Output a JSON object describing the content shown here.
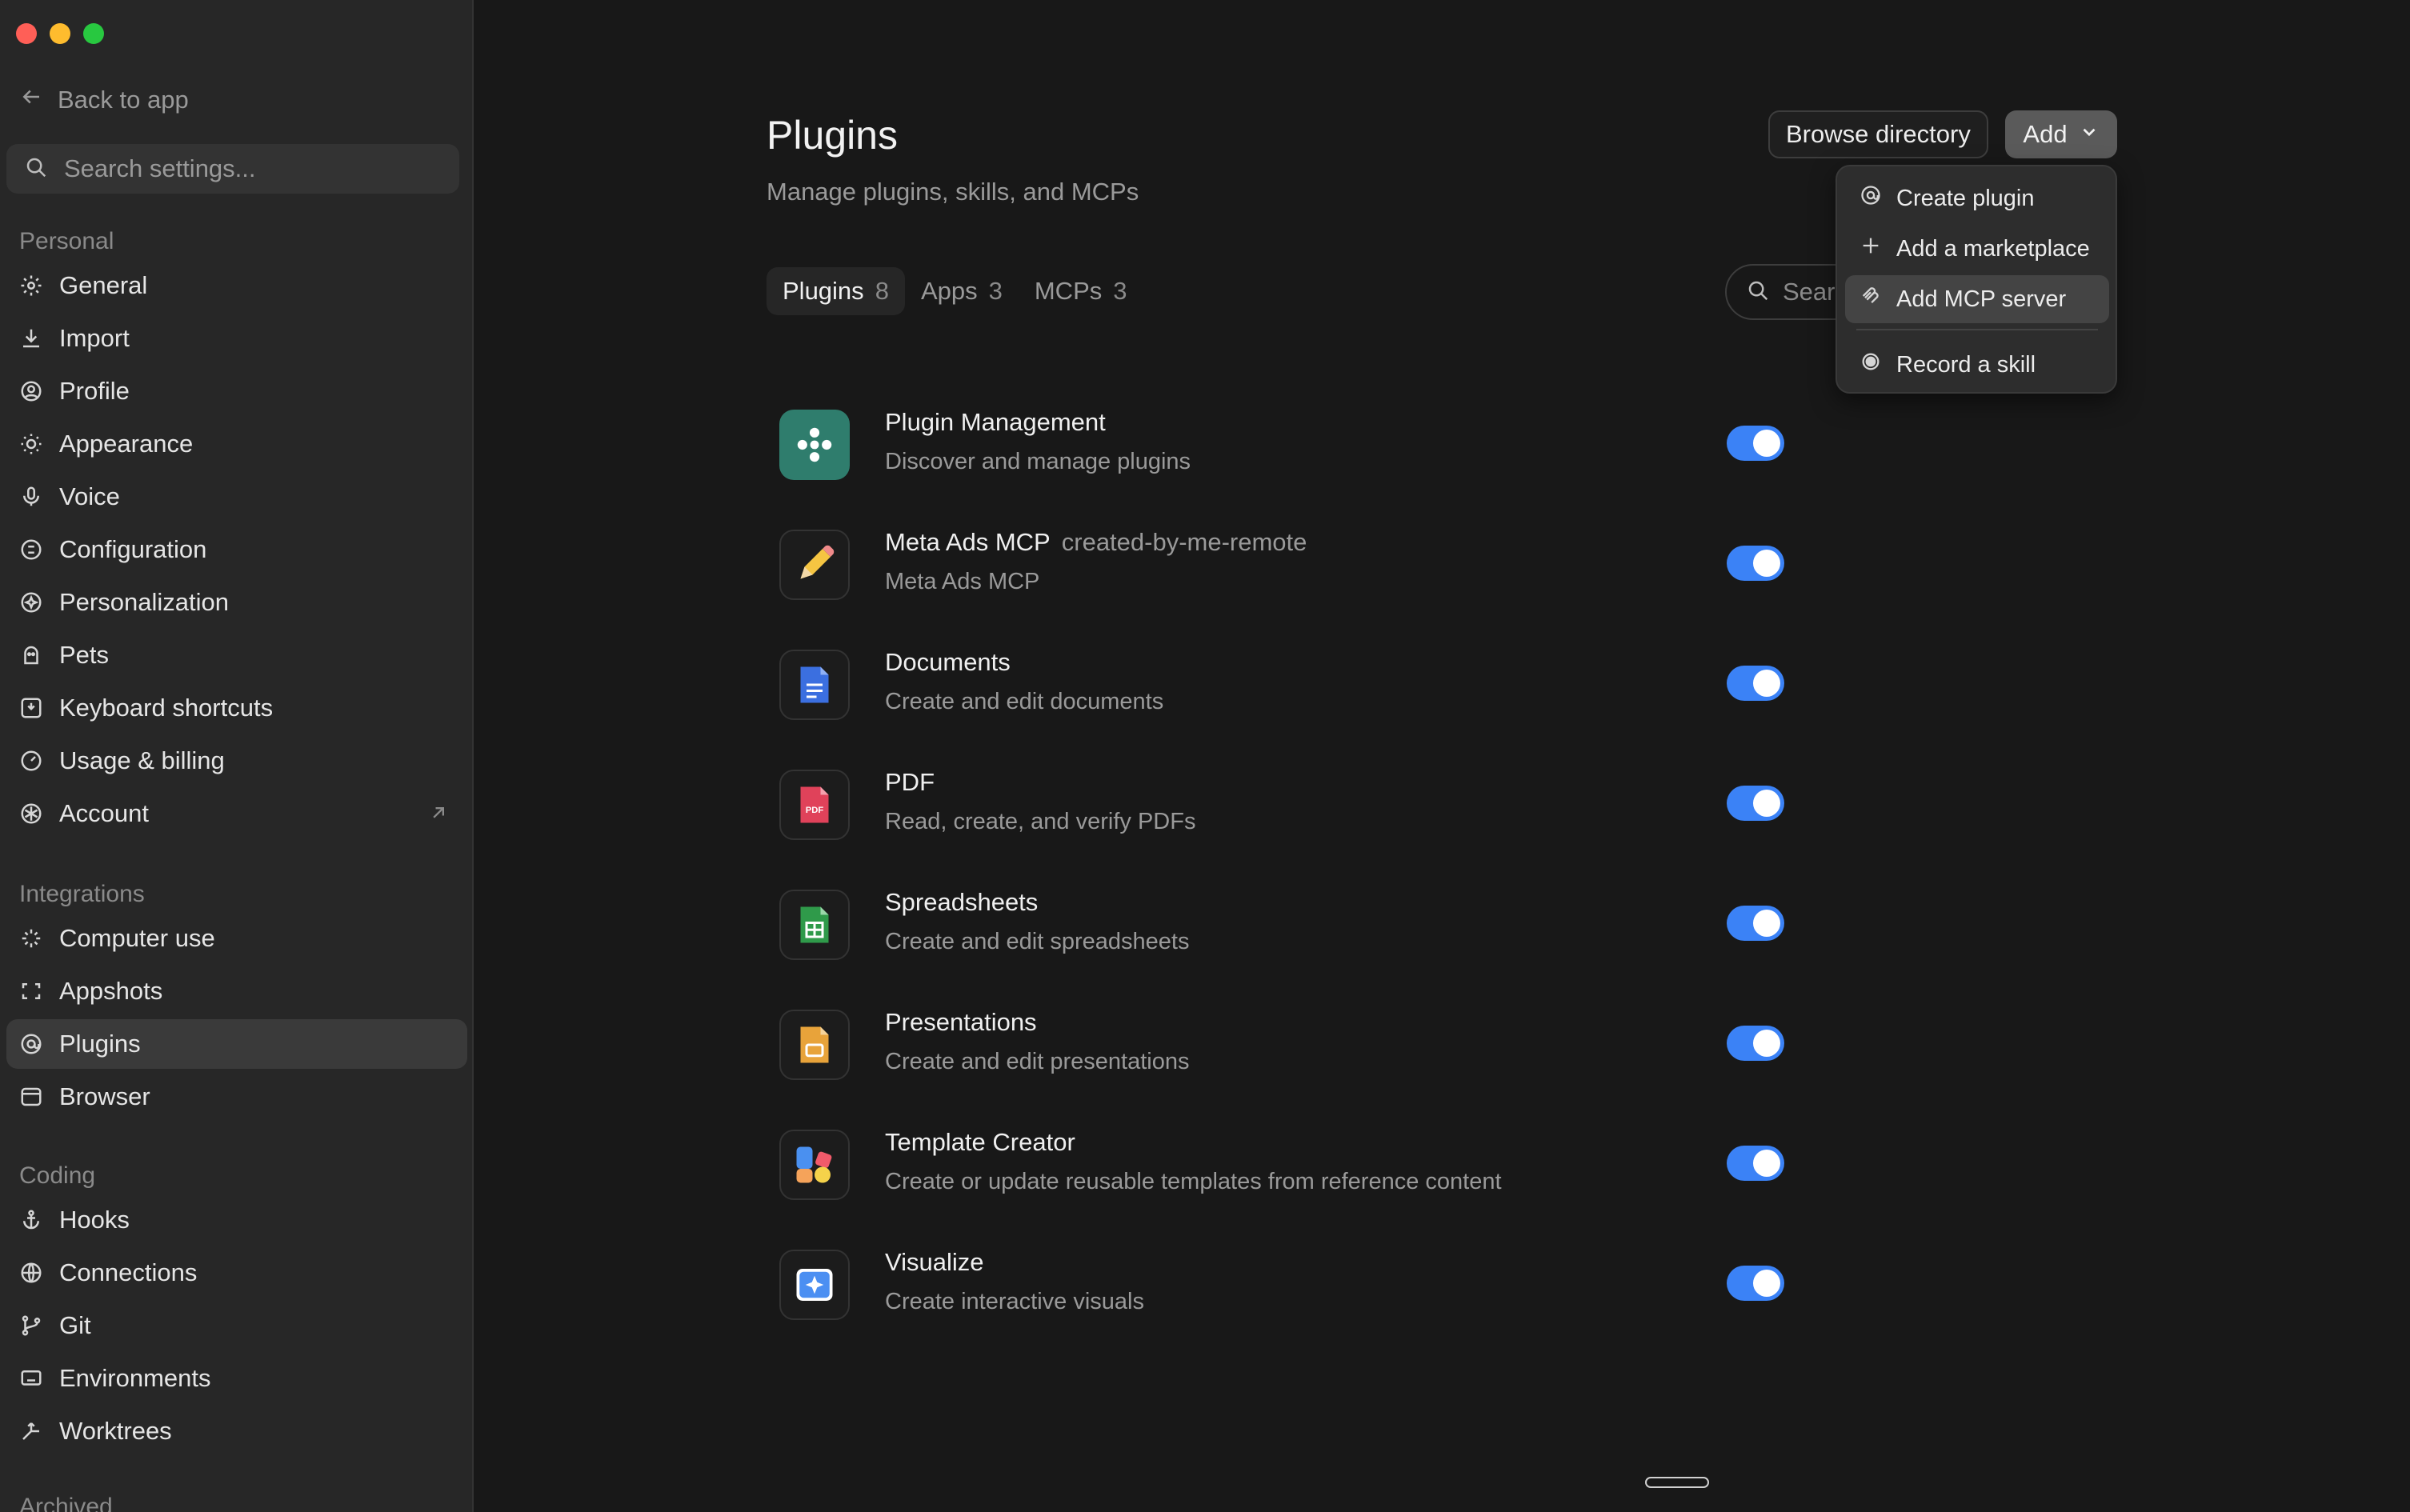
{
  "window": {
    "controls": [
      {
        "name": "close",
        "color": "#ff5f57"
      },
      {
        "name": "minimize",
        "color": "#febc2e"
      },
      {
        "name": "maximize",
        "color": "#28c840"
      }
    ]
  },
  "sidebar": {
    "back_label": "Back to app",
    "search_placeholder": "Search settings...",
    "sections": {
      "personal": {
        "title": "Personal",
        "items": [
          {
            "label": "General",
            "icon": "gear-icon"
          },
          {
            "label": "Import",
            "icon": "download-icon"
          },
          {
            "label": "Profile",
            "icon": "user-icon"
          },
          {
            "label": "Appearance",
            "icon": "sun-icon"
          },
          {
            "label": "Voice",
            "icon": "microphone-icon"
          },
          {
            "label": "Configuration",
            "icon": "sliders-icon"
          },
          {
            "label": "Personalization",
            "icon": "sparkle-icon"
          },
          {
            "label": "Pets",
            "icon": "pet-icon"
          },
          {
            "label": "Keyboard shortcuts",
            "icon": "keyboard-icon"
          },
          {
            "label": "Usage & billing",
            "icon": "gauge-icon"
          },
          {
            "label": "Account",
            "icon": "openai-icon",
            "external": true
          }
        ]
      },
      "integrations": {
        "title": "Integrations",
        "items": [
          {
            "label": "Computer use",
            "icon": "cursor-sparkle-icon"
          },
          {
            "label": "Appshots",
            "icon": "screenshot-icon"
          },
          {
            "label": "Plugins",
            "icon": "plugin-icon",
            "active": true
          },
          {
            "label": "Browser",
            "icon": "browser-icon"
          }
        ]
      },
      "coding": {
        "title": "Coding",
        "items": [
          {
            "label": "Hooks",
            "icon": "anchor-icon"
          },
          {
            "label": "Connections",
            "icon": "globe-icon"
          },
          {
            "label": "Git",
            "icon": "git-branch-icon"
          },
          {
            "label": "Environments",
            "icon": "monitor-icon"
          },
          {
            "label": "Worktrees",
            "icon": "worktree-icon"
          }
        ]
      },
      "archived": {
        "title": "Archived"
      }
    }
  },
  "main": {
    "title": "Plugins",
    "subtitle": "Manage plugins, skills, and MCPs",
    "browse_label": "Browse directory",
    "add_label": "Add",
    "tabs": [
      {
        "label": "Plugins",
        "count": "8",
        "active": true
      },
      {
        "label": "Apps",
        "count": "3"
      },
      {
        "label": "MCPs",
        "count": "3"
      }
    ],
    "search_placeholder": "Search",
    "plugins": [
      {
        "name": "Plugin Management",
        "tag": "",
        "desc": "Discover and manage plugins",
        "icon": "plugin-management-icon",
        "enabled": true
      },
      {
        "name": "Meta Ads MCP",
        "tag": "created-by-me-remote",
        "desc": "Meta Ads MCP",
        "icon": "pencil-icon",
        "enabled": true
      },
      {
        "name": "Documents",
        "tag": "",
        "desc": "Create and edit documents",
        "icon": "document-icon",
        "enabled": true
      },
      {
        "name": "PDF",
        "tag": "",
        "desc": "Read, create, and verify PDFs",
        "icon": "pdf-icon",
        "icon_text": "PDF",
        "enabled": true
      },
      {
        "name": "Spreadsheets",
        "tag": "",
        "desc": "Create and edit spreadsheets",
        "icon": "spreadsheet-icon",
        "enabled": true
      },
      {
        "name": "Presentations",
        "tag": "",
        "desc": "Create and edit presentations",
        "icon": "presentation-icon",
        "enabled": true
      },
      {
        "name": "Template Creator",
        "tag": "",
        "desc": "Create or update reusable templates from reference content",
        "icon": "template-icon",
        "enabled": true
      },
      {
        "name": "Visualize",
        "tag": "",
        "desc": "Create interactive visuals",
        "icon": "visualize-icon",
        "enabled": true
      }
    ]
  },
  "add_menu": {
    "items": [
      {
        "label": "Create plugin",
        "icon": "plugin-icon"
      },
      {
        "label": "Add a marketplace",
        "icon": "plus-icon"
      },
      {
        "label": "Add MCP server",
        "icon": "mcp-icon",
        "highlight": true
      },
      {
        "label": "Record a skill",
        "icon": "record-icon"
      }
    ]
  },
  "colors": {
    "accent": "#3b82f6",
    "background": "#181818",
    "sidebar": "#272727"
  }
}
